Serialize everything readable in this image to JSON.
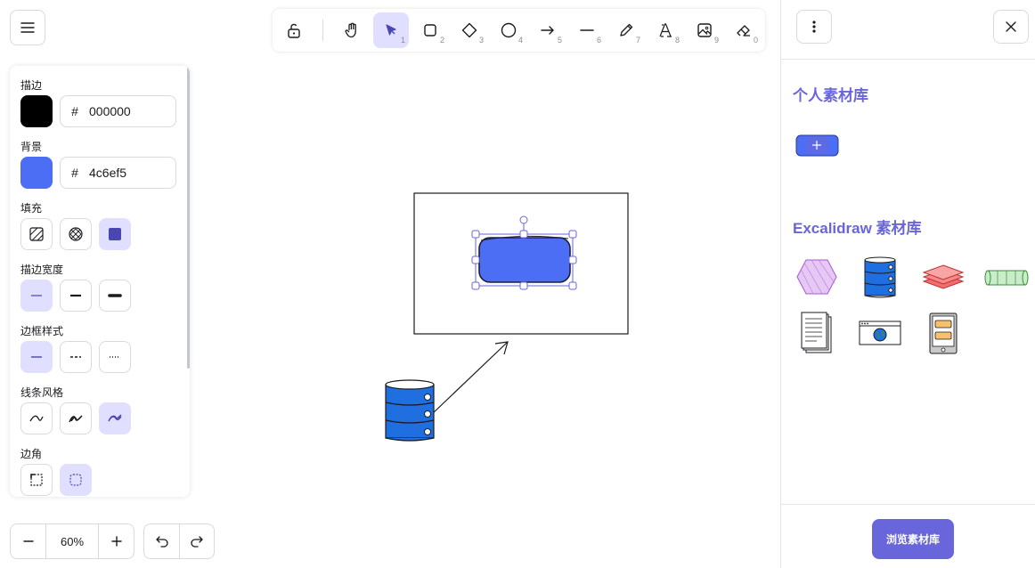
{
  "properties": {
    "stroke": {
      "label": "描边",
      "color": "#000000",
      "hex": "000000"
    },
    "background": {
      "label": "背景",
      "color": "#4c6ef5",
      "hex": "4c6ef5"
    },
    "fill": {
      "label": "填充",
      "options": [
        "hachure",
        "cross-hatch",
        "solid"
      ],
      "selected": "solid"
    },
    "stroke_width": {
      "label": "描边宽度",
      "options": [
        "thin",
        "bold",
        "extra-bold"
      ],
      "selected": "thin"
    },
    "stroke_style": {
      "label": "边框样式",
      "options": [
        "solid",
        "dashed",
        "dotted"
      ],
      "selected": "solid"
    },
    "sloppiness": {
      "label": "线条风格",
      "options": [
        "architect",
        "artist",
        "cartoonist"
      ],
      "selected": "cartoonist"
    },
    "edges": {
      "label": "边角",
      "options": [
        "sharp",
        "round"
      ],
      "selected": "round"
    },
    "hash": "#"
  },
  "toolbar": {
    "tools": [
      {
        "name": "lock",
        "key": ""
      },
      {
        "name": "hand",
        "key": ""
      },
      {
        "name": "selection",
        "key": "1",
        "selected": true
      },
      {
        "name": "rectangle",
        "key": "2"
      },
      {
        "name": "diamond",
        "key": "3"
      },
      {
        "name": "ellipse",
        "key": "4"
      },
      {
        "name": "arrow",
        "key": "5"
      },
      {
        "name": "line",
        "key": "6"
      },
      {
        "name": "draw",
        "key": "7"
      },
      {
        "name": "text",
        "key": "8"
      },
      {
        "name": "image",
        "key": "9"
      },
      {
        "name": "eraser",
        "key": "0"
      }
    ]
  },
  "sidebar": {
    "personal_title": "个人素材库",
    "excalidraw_title": "Excalidraw 素材库",
    "library_items": [
      "hexagon",
      "database",
      "layers",
      "cylinder",
      "documents",
      "browser-window",
      "tablet"
    ],
    "browse_button": "浏览素材库"
  },
  "zoom": {
    "value": "60%"
  },
  "colors": {
    "accent": "#6965db",
    "selected_bg": "#e0dfff",
    "shape_fill": "#4c6ef5",
    "database_fill": "#1f6fe0"
  }
}
